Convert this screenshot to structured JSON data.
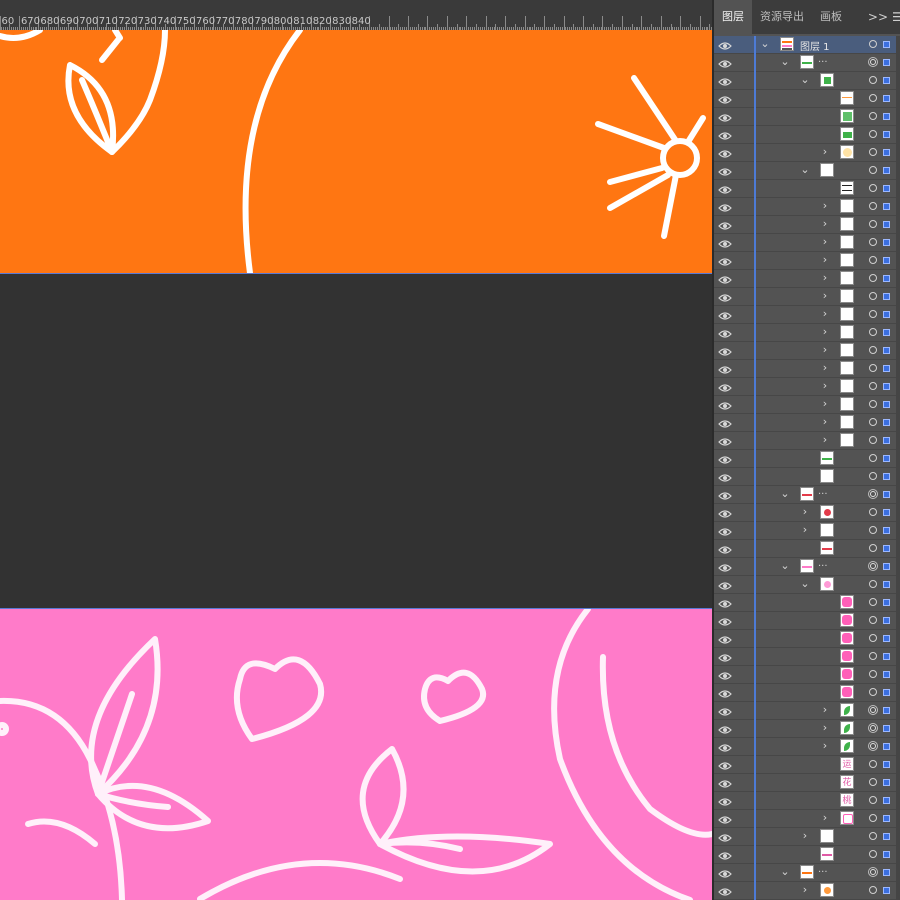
{
  "ruler": {
    "labels": [
      "60",
      "670",
      "680",
      "690",
      "700",
      "710",
      "720",
      "730",
      "740",
      "750",
      "760",
      "770",
      "780",
      "790",
      "800",
      "810",
      "820",
      "830",
      "840"
    ]
  },
  "panel": {
    "tabs": [
      {
        "label": "图层",
        "active": true
      },
      {
        "label": "资源导出",
        "active": false
      },
      {
        "label": "画板",
        "active": false
      }
    ],
    "more_label": ">>",
    "menu_label": "☰",
    "top_layer_name": "图层 1",
    "collapsed_name": "...",
    "rows": [
      {
        "indent": 0,
        "arrow": "down",
        "thumb": "stripe",
        "name": "top",
        "target": "single",
        "top": true
      },
      {
        "indent": 1,
        "arrow": "down",
        "thumb": "green-dash",
        "name": "dots",
        "target": "double"
      },
      {
        "indent": 2,
        "arrow": "down",
        "thumb": "green-grid",
        "target": "single"
      },
      {
        "indent": 3,
        "thumb": "orange-dots",
        "target": "single"
      },
      {
        "indent": 3,
        "thumb": "green-sq",
        "target": "single"
      },
      {
        "indent": 3,
        "thumb": "green-sq2",
        "target": "single"
      },
      {
        "indent": 3,
        "arrow": "right",
        "thumb": "sun",
        "target": "single"
      },
      {
        "indent": 2,
        "arrow": "down",
        "thumb": "white",
        "target": "single"
      },
      {
        "indent": 3,
        "thumb": "lines",
        "target": "single"
      },
      {
        "indent": 3,
        "arrow": "right",
        "thumb": "white",
        "target": "single"
      },
      {
        "indent": 3,
        "arrow": "right",
        "thumb": "white",
        "target": "single"
      },
      {
        "indent": 3,
        "arrow": "right",
        "thumb": "white",
        "target": "single"
      },
      {
        "indent": 3,
        "arrow": "right",
        "thumb": "white",
        "target": "single"
      },
      {
        "indent": 3,
        "arrow": "right",
        "thumb": "white",
        "target": "single"
      },
      {
        "indent": 3,
        "arrow": "right",
        "thumb": "white",
        "target": "single"
      },
      {
        "indent": 3,
        "arrow": "right",
        "thumb": "white",
        "target": "single"
      },
      {
        "indent": 3,
        "arrow": "right",
        "thumb": "white",
        "target": "single"
      },
      {
        "indent": 3,
        "arrow": "right",
        "thumb": "white",
        "target": "single"
      },
      {
        "indent": 3,
        "arrow": "right",
        "thumb": "white",
        "target": "single"
      },
      {
        "indent": 3,
        "arrow": "right",
        "thumb": "white",
        "target": "single"
      },
      {
        "indent": 3,
        "arrow": "right",
        "thumb": "white",
        "target": "single"
      },
      {
        "indent": 3,
        "arrow": "right",
        "thumb": "white",
        "target": "single"
      },
      {
        "indent": 3,
        "arrow": "right",
        "thumb": "white",
        "target": "single"
      },
      {
        "indent": 2,
        "thumb": "green-line",
        "target": "single"
      },
      {
        "indent": 2,
        "thumb": "white",
        "target": "single"
      },
      {
        "indent": 1,
        "arrow": "down",
        "thumb": "red-dash",
        "name": "dots",
        "target": "double"
      },
      {
        "indent": 2,
        "arrow": "right",
        "thumb": "red-flower",
        "target": "single"
      },
      {
        "indent": 2,
        "arrow": "right",
        "thumb": "white",
        "target": "single"
      },
      {
        "indent": 2,
        "thumb": "red-line",
        "target": "single"
      },
      {
        "indent": 1,
        "arrow": "down",
        "thumb": "pink-dash",
        "name": "dots",
        "target": "double"
      },
      {
        "indent": 2,
        "arrow": "down",
        "thumb": "pink-flower",
        "target": "single"
      },
      {
        "indent": 3,
        "thumb": "pink",
        "target": "single"
      },
      {
        "indent": 3,
        "thumb": "pink",
        "target": "single"
      },
      {
        "indent": 3,
        "thumb": "pink",
        "target": "single"
      },
      {
        "indent": 3,
        "thumb": "pink",
        "target": "single"
      },
      {
        "indent": 3,
        "thumb": "pink",
        "target": "single"
      },
      {
        "indent": 3,
        "thumb": "pink",
        "target": "single"
      },
      {
        "indent": 3,
        "arrow": "right",
        "thumb": "leaf",
        "target": "double"
      },
      {
        "indent": 3,
        "arrow": "right",
        "thumb": "leaf",
        "target": "double"
      },
      {
        "indent": 3,
        "arrow": "right",
        "thumb": "leaf",
        "target": "double"
      },
      {
        "indent": 3,
        "thumb": "char",
        "char": "运",
        "target": "single"
      },
      {
        "indent": 3,
        "thumb": "char",
        "char": "花",
        "target": "single"
      },
      {
        "indent": 3,
        "thumb": "char",
        "char": "桃",
        "target": "single"
      },
      {
        "indent": 3,
        "arrow": "right",
        "thumb": "heart",
        "target": "single"
      },
      {
        "indent": 2,
        "arrow": "right",
        "thumb": "white",
        "target": "single"
      },
      {
        "indent": 2,
        "thumb": "pink-line",
        "target": "single"
      },
      {
        "indent": 1,
        "arrow": "down",
        "thumb": "orange-dash",
        "name": "dots",
        "target": "double"
      },
      {
        "indent": 2,
        "arrow": "right",
        "thumb": "orange-flower",
        "target": "single"
      }
    ]
  },
  "colors": {
    "orange": "#ff7612",
    "pink": "#ff7bc9",
    "canvas": "#323232",
    "panel": "#535353",
    "accent": "#4d7bd6"
  }
}
